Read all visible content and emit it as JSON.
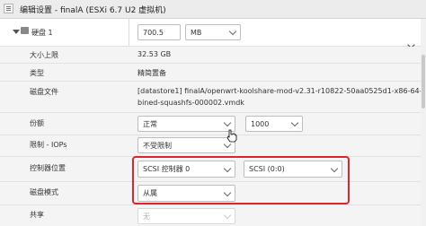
{
  "window": {
    "title": "编辑设置 - finalA (ESXi 6.7 U2 虚拟机)"
  },
  "disk": {
    "label": "硬盘 1",
    "size_value": "700.5",
    "size_unit": "MB"
  },
  "rows": {
    "max_size": {
      "label": "大小上限",
      "value": "32.53 GB"
    },
    "type": {
      "label": "类型",
      "value": "精简置备"
    },
    "disk_file": {
      "label": "磁盘文件",
      "line1": "[datastore1] finalA/openwrt-koolshare-mod-v2.31-r10822-50aa0525d1-x86-64-com",
      "line2": "bined-squashfs-000002.vmdk"
    },
    "shares": {
      "label": "份额",
      "select": "正常",
      "number": "1000"
    },
    "limit_iops": {
      "label": "限制 - IOPs",
      "select": "不受限制"
    },
    "controller": {
      "label": "控制器位置",
      "controller": "SCSI 控制器 0",
      "node": "SCSI (0:0)"
    },
    "disk_mode": {
      "label": "磁盘模式",
      "select": "从属"
    },
    "sharing": {
      "label": "共享",
      "select": "无"
    }
  }
}
